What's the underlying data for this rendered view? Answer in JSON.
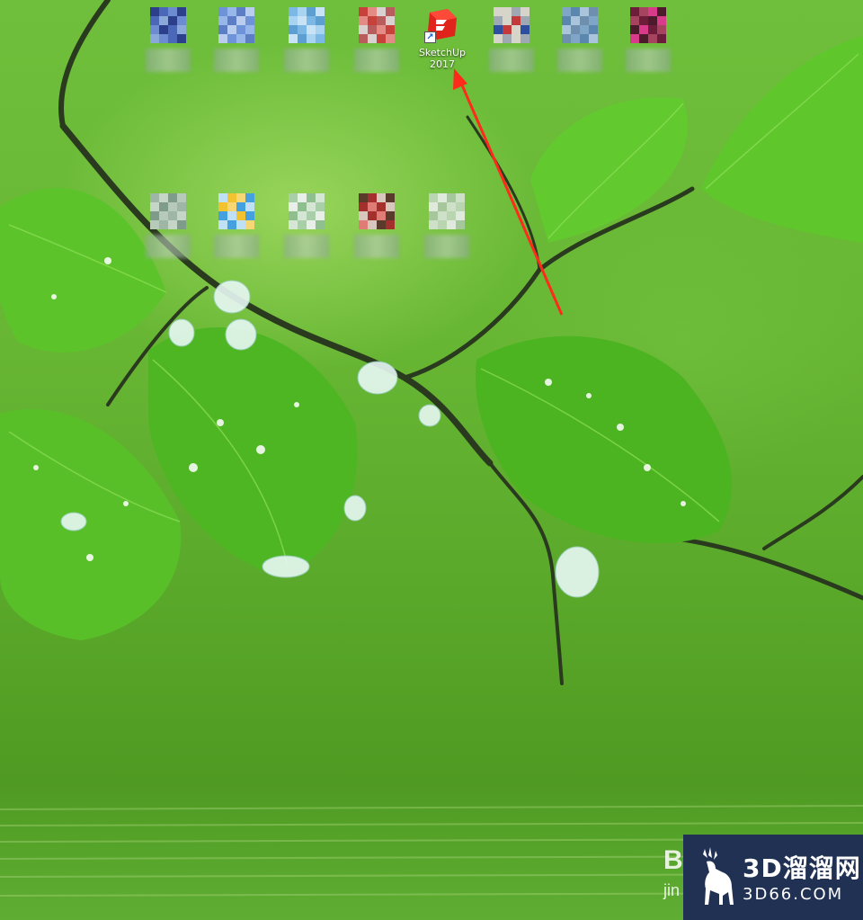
{
  "desktop": {
    "shortcut": {
      "label_line1": "SketchUp",
      "label_line2": "2017",
      "icon": "sketchup-icon"
    },
    "pixelated_icons_row1": [
      {
        "colors": [
          "#2b3f8a",
          "#4a67b8",
          "#6d8bd0",
          "#8aa8d8"
        ]
      },
      {
        "colors": [
          "#6f93d8",
          "#97b6ea",
          "#5d7ec4",
          "#b9cdee"
        ]
      },
      {
        "colors": [
          "#7cb8e6",
          "#a8d4f2",
          "#5e9fd2",
          "#c8e2f6"
        ]
      },
      {
        "colors": [
          "#c8423c",
          "#e58b86",
          "#d9d0cf",
          "#b85c5c"
        ]
      },
      {
        "colors": [
          "#d7d5c9",
          "#c33a3a",
          "#9fa9b3",
          "#2e4fa0"
        ]
      },
      {
        "colors": [
          "#7fa6c7",
          "#5b86ad",
          "#a9c4db",
          "#6f8fae"
        ]
      },
      {
        "colors": [
          "#6c1d3a",
          "#a6445f",
          "#d73b8a",
          "#4b1a2b"
        ]
      }
    ],
    "pixelated_icons_row2": [
      {
        "colors": [
          "#9fb6a6",
          "#c6d6c6",
          "#7f9b8a",
          "#b7c9b8"
        ]
      },
      {
        "colors": [
          "#f2c230",
          "#45a0e0",
          "#bfe0f5",
          "#f7d774"
        ]
      },
      {
        "colors": [
          "#a8cfa8",
          "#e8efe8",
          "#8fbf8f",
          "#d5e6d5"
        ]
      },
      {
        "colors": [
          "#a4302d",
          "#e07c76",
          "#5a3b2b",
          "#d9c6bd"
        ]
      },
      {
        "colors": [
          "#b9d6b0",
          "#dfeadc",
          "#a6c69b",
          "#cfe0c9"
        ]
      }
    ],
    "annotation": {
      "color": "#ff2a1a"
    }
  },
  "watermark": {
    "logo_icon": "deer-icon",
    "brand": "3D溜溜网",
    "domain": "3D66.COM",
    "background": "#203153"
  },
  "baidu": {
    "mark": "B",
    "sub": "jin"
  }
}
